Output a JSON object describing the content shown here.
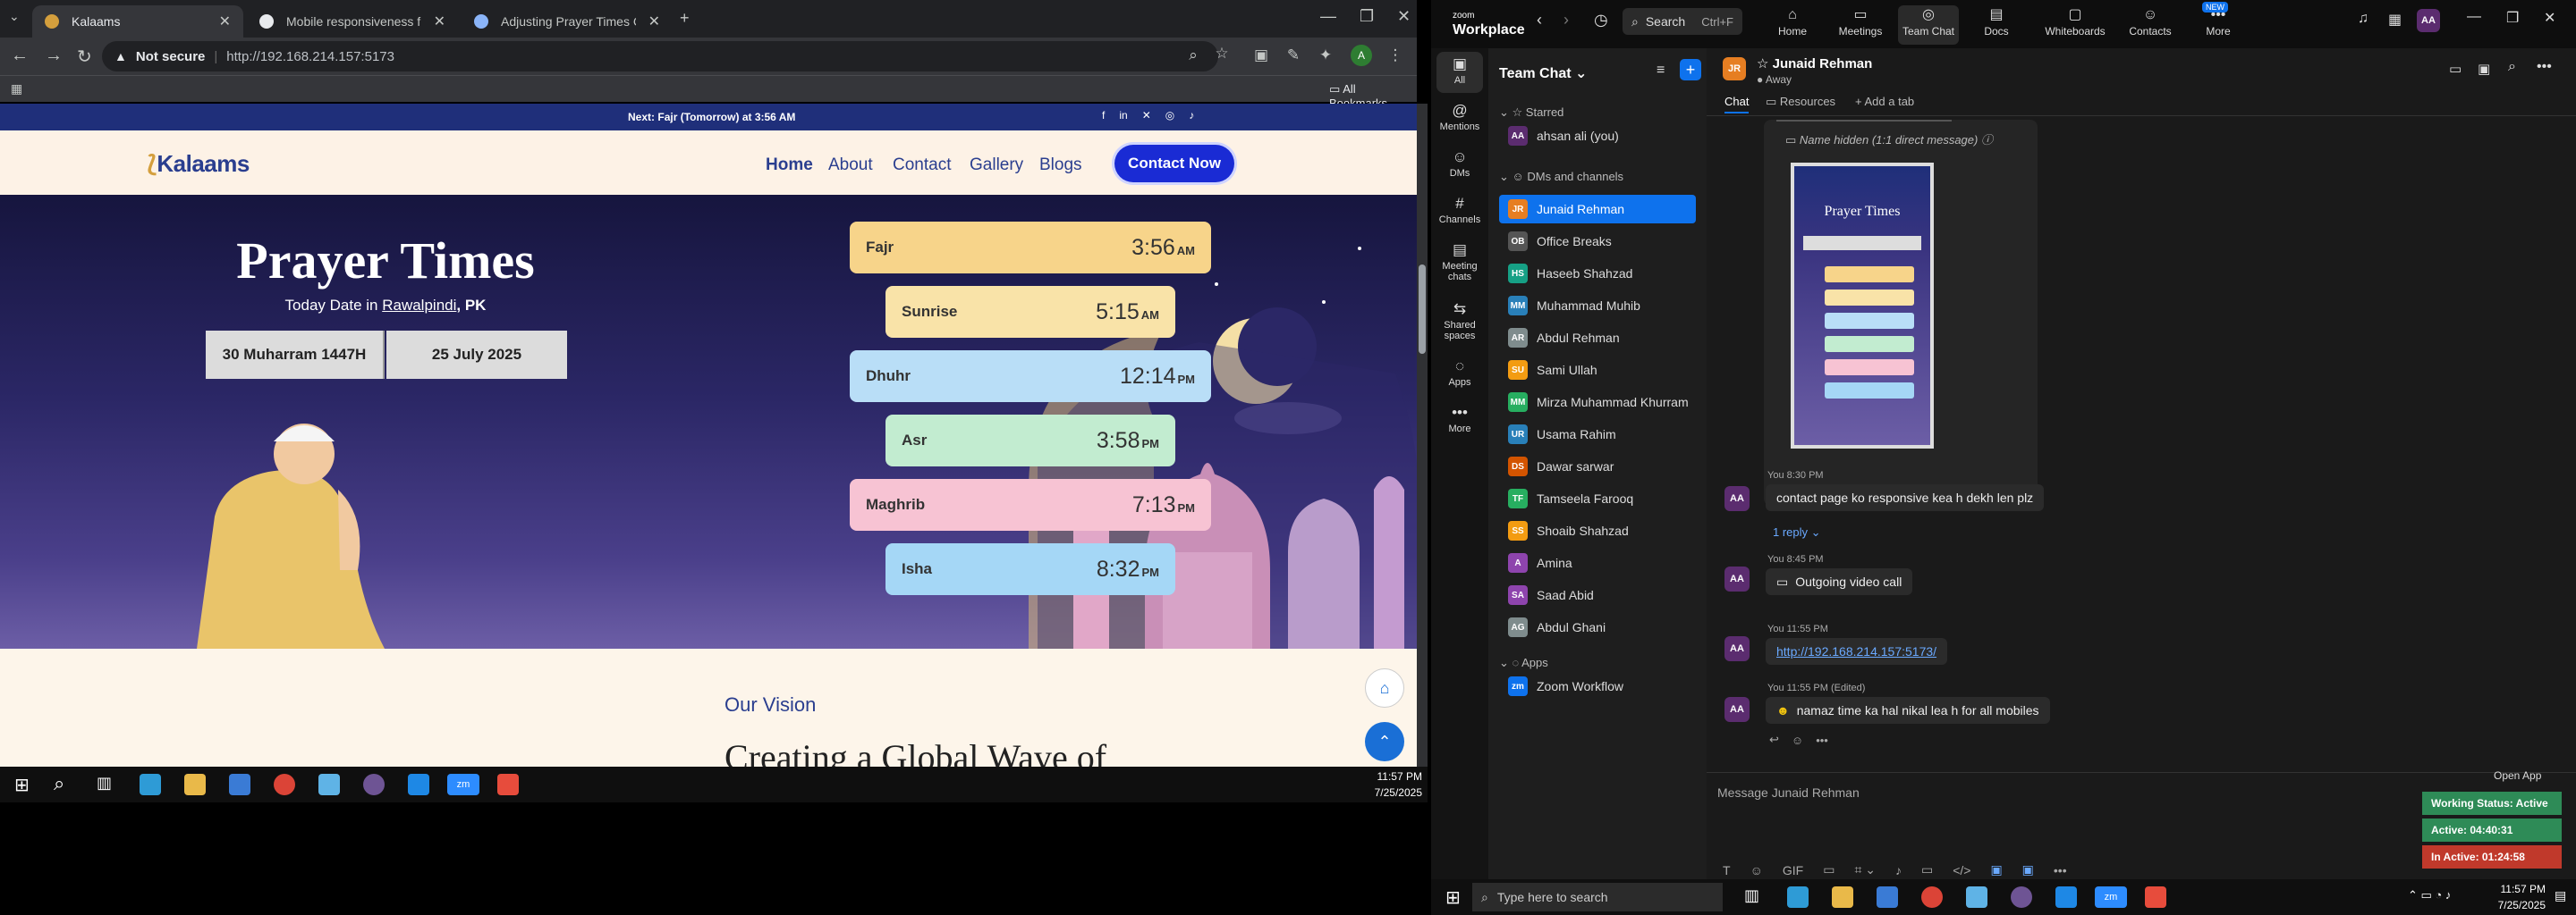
{
  "browser": {
    "tabs": [
      {
        "title": "Kalaams",
        "favicon_color": "#d49f3d",
        "active": true
      },
      {
        "title": "Mobile responsiveness fix",
        "favicon_color": "#e8eaed",
        "active": false
      },
      {
        "title": "Adjusting Prayer Times Contain",
        "favicon_color": "#8ab4f8",
        "active": false
      }
    ],
    "new_tab": "+",
    "not_secure": "Not secure",
    "url": "http://192.168.214.157:5173",
    "all_bookmarks": "All Bookmarks"
  },
  "site": {
    "top_strip": {
      "prefix": "Next:",
      "next_name": "Fajr (Tomorrow)",
      "suffix": "at 3:56 AM"
    },
    "social_icons": [
      "f",
      "in",
      "✕",
      "◎",
      "♪"
    ],
    "logo": "Kalaams",
    "logo_mark": "⟅",
    "nav": [
      "Home",
      "About",
      "Contact",
      "Gallery",
      "Blogs"
    ],
    "cta": "Contact Now",
    "hero": {
      "title": "Prayer Times",
      "today_prefix": "Today Date in",
      "city": "Rawalpindi",
      "country": ", PK",
      "hijri": "30 Muharram 1447H",
      "gregorian": "25 July 2025"
    },
    "prayers": [
      {
        "name": "Fajr",
        "time": "3:56",
        "ampm": "AM",
        "color": "#f7d48a"
      },
      {
        "name": "Sunrise",
        "time": "5:15",
        "ampm": "AM",
        "color": "#f9e3a8"
      },
      {
        "name": "Dhuhr",
        "time": "12:14",
        "ampm": "PM",
        "color": "#b9def7"
      },
      {
        "name": "Asr",
        "time": "3:58",
        "ampm": "PM",
        "color": "#c2ecd0"
      },
      {
        "name": "Maghrib",
        "time": "7:13",
        "ampm": "PM",
        "color": "#f7c3d3"
      },
      {
        "name": "Isha",
        "time": "8:32",
        "ampm": "PM",
        "color": "#a5d7f6"
      }
    ],
    "vision_label": "Our Vision",
    "vision_heading": "Creating a Global Wave of"
  },
  "taskbar_left": {
    "time": "11:57 PM",
    "date": "7/25/2025"
  },
  "zoom": {
    "brand_top": "zoom",
    "brand_bottom": "Workplace",
    "search": "Search",
    "search_kb": "Ctrl+F",
    "top_tabs": [
      {
        "label": "Home",
        "icon": "⌂"
      },
      {
        "label": "Meetings",
        "icon": "▭"
      },
      {
        "label": "Team Chat",
        "icon": "◎"
      },
      {
        "label": "Docs",
        "icon": "▤"
      },
      {
        "label": "Whiteboards",
        "icon": "▢"
      },
      {
        "label": "Contacts",
        "icon": "☺"
      },
      {
        "label": "More",
        "icon": "•••"
      }
    ],
    "new_badge": "NEW",
    "user_initials": "AA",
    "rail": [
      {
        "label": "All",
        "icon": "▣"
      },
      {
        "label": "Mentions",
        "icon": "@"
      },
      {
        "label": "DMs",
        "icon": "☺"
      },
      {
        "label": "Channels",
        "icon": "#"
      },
      {
        "label": "Meeting chats",
        "icon": "▤"
      },
      {
        "label": "Shared spaces",
        "icon": "⇆"
      },
      {
        "label": "Apps",
        "icon": "◌"
      },
      {
        "label": "More",
        "icon": "•••"
      }
    ],
    "list_title": "Team Chat",
    "sections": {
      "starred": "Starred",
      "dms": "DMs and channels",
      "apps": "Apps"
    },
    "starred": [
      {
        "name": "ahsan ali (you)",
        "initials": "AA",
        "color": "#5b2c6f"
      }
    ],
    "contacts": [
      {
        "name": "Junaid Rehman",
        "initials": "JR",
        "color": "#e67e22"
      },
      {
        "name": "Office Breaks",
        "initials": "OB",
        "color": "#555555"
      },
      {
        "name": "Haseeb Shahzad",
        "initials": "HS",
        "color": "#16a085"
      },
      {
        "name": "Muhammad Muhib",
        "initials": "MM",
        "color": "#2980b9"
      },
      {
        "name": "Abdul Rehman",
        "initials": "AR",
        "color": "#7f8c8d"
      },
      {
        "name": "Sami Ullah",
        "initials": "SU",
        "color": "#f39c12"
      },
      {
        "name": "Mirza Muhammad Khurram",
        "initials": "MM",
        "color": "#27ae60"
      },
      {
        "name": "Usama Rahim",
        "initials": "UR",
        "color": "#2980b9"
      },
      {
        "name": "Dawar sarwar",
        "initials": "DS",
        "color": "#d35400"
      },
      {
        "name": "Tamseela Farooq",
        "initials": "TF",
        "color": "#27ae60"
      },
      {
        "name": "Shoaib Shahzad",
        "initials": "SS",
        "color": "#f39c12"
      },
      {
        "name": "Amina",
        "initials": "A",
        "color": "#8e44ad"
      },
      {
        "name": "Saad Abid",
        "initials": "SA",
        "color": "#8e44ad"
      },
      {
        "name": "Abdul Ghani",
        "initials": "AG",
        "color": "#7f8c8d"
      }
    ],
    "apps": [
      {
        "name": "Zoom Workflow",
        "initials": "zm",
        "color": "#0e72ed"
      }
    ],
    "chat": {
      "name": "Junaid Rehman",
      "initials": "JR",
      "status": "Away",
      "tabs": [
        "Chat",
        "Resources",
        "Add a tab"
      ],
      "hidden_name": "Name hidden (1:1 direct message)",
      "thumb_title": "Prayer Times",
      "messages": [
        {
          "meta": "You 8:30 PM",
          "text": "contact page ko responsive kea h dekh len plz"
        },
        {
          "meta": "You 8:45 PM",
          "text": "Outgoing video call"
        },
        {
          "meta": "You 11:55 PM",
          "text": "http://192.168.214.157:5173/"
        },
        {
          "meta": "You 11:55 PM (Edited)",
          "text": "namaz time ka hal nikal lea h for all mobiles"
        }
      ],
      "reply": "1 reply",
      "placeholder": "Message Junaid Rehman",
      "open_app": "Open App"
    },
    "work_status": [
      {
        "label": "Working Status: Active",
        "color": "#2e8b57"
      },
      {
        "label": "Active: 04:40:31",
        "color": "#2e8b57"
      },
      {
        "label": "In Active: 01:24:58",
        "color": "#c0392b"
      }
    ]
  },
  "taskbar_right": {
    "search_placeholder": "Type here to search",
    "time": "11:57 PM",
    "date": "7/25/2025"
  }
}
